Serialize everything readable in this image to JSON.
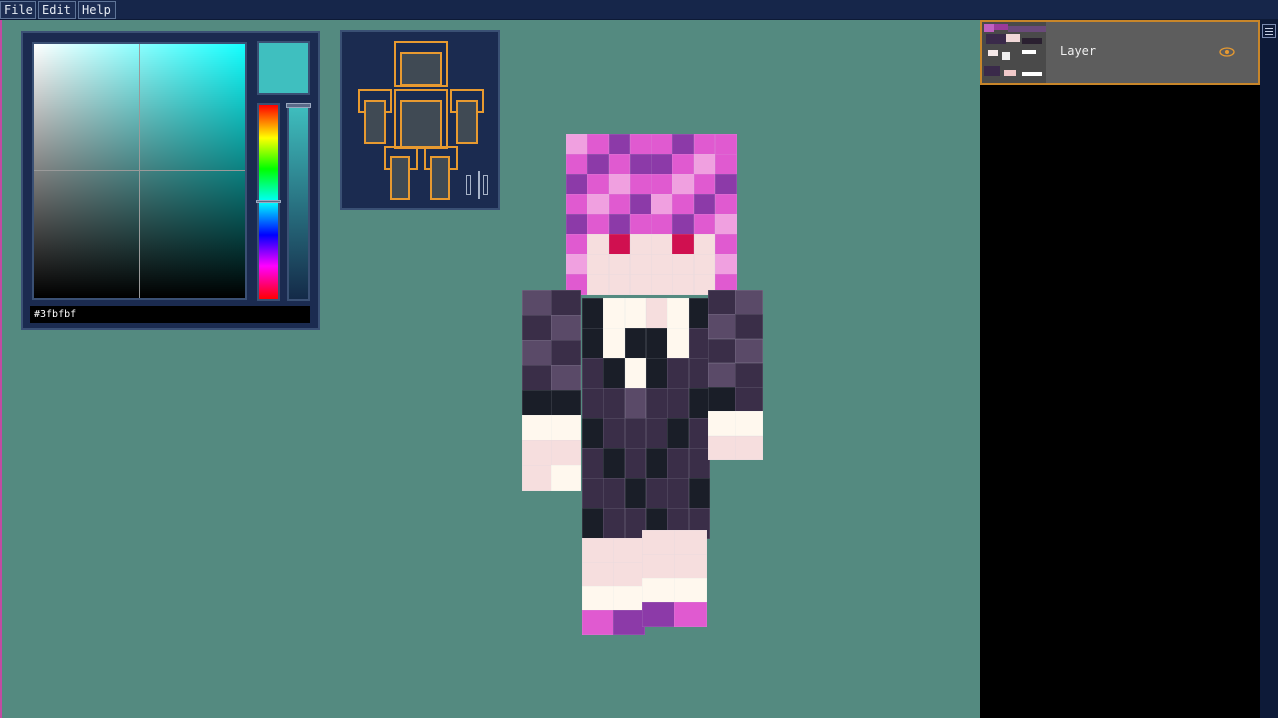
{
  "menu": {
    "items": [
      {
        "label": "File"
      },
      {
        "label": "Edit"
      },
      {
        "label": "Help"
      }
    ]
  },
  "color_picker": {
    "hex_value": "#3fbfbf",
    "current_color": "#3fbfbf"
  },
  "body_parts": {
    "parts": [
      "head",
      "torso",
      "right-arm",
      "left-arm",
      "right-leg",
      "left-leg"
    ],
    "mirror_icon": "mirror-icon"
  },
  "layers": {
    "items": [
      {
        "name": "Layer",
        "visible": true
      }
    ],
    "visibility_icon": "eye-icon",
    "menu_icon": "hamburger-icon"
  },
  "colors": {
    "viewport_background": "#548a80",
    "panel_background": "#1b2b50",
    "accent_orange": "#e89a30"
  }
}
